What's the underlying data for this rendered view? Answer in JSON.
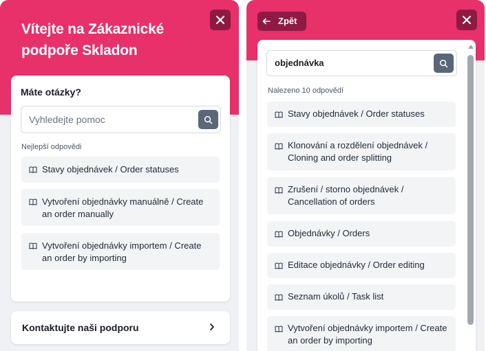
{
  "left": {
    "welcome_title": "Vítejte na Zákaznické podpoře Skladon",
    "questions_title": "Máte otázky?",
    "search_placeholder": "Vyhledejte pomoc",
    "section_label": "Nejlepší odpovědi",
    "items": [
      {
        "label": "Stavy objednávek / Order statuses"
      },
      {
        "label": "Vytvoření objednávky manuálně / Create an order manually"
      },
      {
        "label": "Vytvoření objednávky importem / Create an order by importing"
      }
    ],
    "contact_label": "Kontaktujte naši podporu"
  },
  "right": {
    "back_label": "Zpět",
    "search_value": "objednávka",
    "section_label": "Nalezeno 10 odpovědí",
    "items": [
      {
        "label": "Stavy objednávek / Order statuses"
      },
      {
        "label": "Klonování a rozdělení objednávek / Cloning and order splitting"
      },
      {
        "label": "Zrušení / storno objednávek / Cancellation of orders"
      },
      {
        "label": "Objednávky / Orders"
      },
      {
        "label": "Editace objednávky / Order editing"
      },
      {
        "label": "Seznam úkolů / Task list"
      },
      {
        "label": "Vytvoření objednávky importem / Create an order by importing"
      }
    ]
  },
  "colors": {
    "brand": "#e8306a",
    "brand_dark": "#8e1a43",
    "search_button": "#5b6778",
    "item_background": "#f3f4f6"
  },
  "icons": [
    "close-icon",
    "search-icon",
    "book-icon",
    "chevron-right-icon",
    "arrow-left-icon"
  ]
}
